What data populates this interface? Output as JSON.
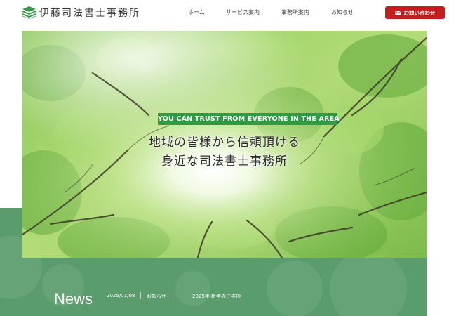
{
  "header": {
    "logo_text": "伊藤司法書士事務所",
    "nav": [
      {
        "label": "ホーム"
      },
      {
        "label": "サービス案内"
      },
      {
        "label": "事務所案内"
      },
      {
        "label": "お知らせ"
      }
    ],
    "contact_label": "お問い合わせ"
  },
  "hero": {
    "tagline": "YOU CAN TRUST FROM EVERYONE IN THE AREA",
    "headline_line1": "地域の皆様から信頼頂ける",
    "headline_line2": "身近な司法書士事務所"
  },
  "news": {
    "title": "News",
    "items": [
      {
        "date": "2025/01/08",
        "category": "お知らせ",
        "text": "2025年 新年のご挨拶"
      }
    ]
  },
  "colors": {
    "brand_green": "#2f9a42",
    "band_green": "#5b9c6d",
    "contact_red": "#c41d1d"
  },
  "icons": [
    "books-logo-icon",
    "mail-icon"
  ]
}
